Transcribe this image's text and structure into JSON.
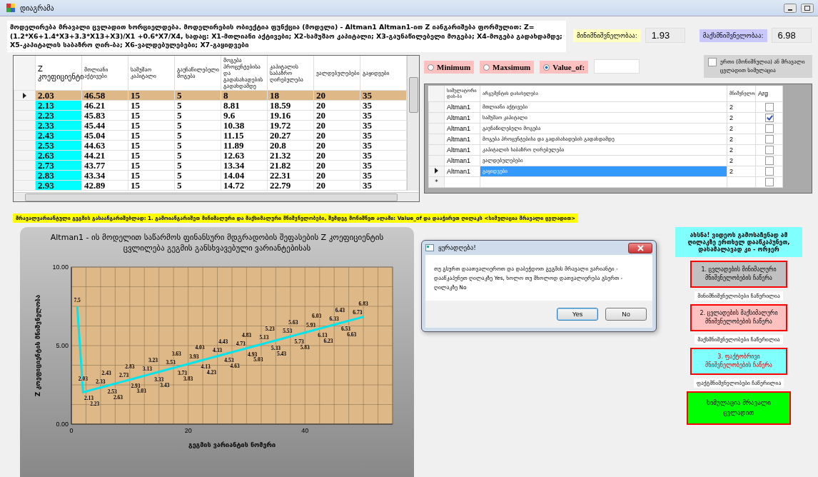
{
  "window": {
    "title": "დიაგრამა"
  },
  "description": "მოდელირება მრავალი ცვლადით ხორციელდება. მოდელირების ობიექტია ფუნქცია (მოდელი) - Altman1  Altman1-ით Z იანგარიშება ფორმულით: Z=(1.2*X6+1.4*X3+3.3*X13+X3)/X1 +0.6*X7/X4, სადაც: X1-მთლიანი აქტივები; X2-სამუშაო კაპიტალი; X3-გაუნაწილებელი მოგება; X4-მოგება გადახდამდე; X5-კაპიტალის საბაზრო ღირ-ბა; X6-ვალდებულებები; X7-გაყიდვები",
  "stats": [
    {
      "kind": "min",
      "label": "მინიმნიშვნელობაა:",
      "value": "1.93"
    },
    {
      "kind": "max",
      "label": "მაქსმნიშვნელობაა:",
      "value": "6.98"
    }
  ],
  "plan_grid": {
    "columns": [
      "Z კოეფიციენტი",
      "მთლიანი აქტივები",
      "სამუშაო კაპიტალი",
      "გაუნაწილებელი მოგება",
      "მოგება პროცენტებისა და გადასახადების გადახდამდე",
      "კაპიტალის საბაზრო ღირებულება",
      "ვალდებულებები",
      "გაყიდვები"
    ],
    "rows": [
      {
        "selected": true,
        "cells": [
          "2.03",
          "46.58",
          "15",
          "5",
          "8",
          "18",
          "20",
          "35"
        ]
      },
      {
        "selected": false,
        "cells": [
          "2.13",
          "46.21",
          "15",
          "5",
          "8.81",
          "18.59",
          "20",
          "35"
        ]
      },
      {
        "selected": false,
        "cells": [
          "2.23",
          "45.83",
          "15",
          "5",
          "9.6",
          "19.16",
          "20",
          "35"
        ]
      },
      {
        "selected": false,
        "cells": [
          "2.33",
          "45.44",
          "15",
          "5",
          "10.38",
          "19.72",
          "20",
          "35"
        ]
      },
      {
        "selected": false,
        "cells": [
          "2.43",
          "45.04",
          "15",
          "5",
          "11.15",
          "20.27",
          "20",
          "35"
        ]
      },
      {
        "selected": false,
        "cells": [
          "2.53",
          "44.63",
          "15",
          "5",
          "11.89",
          "20.8",
          "20",
          "35"
        ]
      },
      {
        "selected": false,
        "cells": [
          "2.63",
          "44.21",
          "15",
          "5",
          "12.63",
          "21.32",
          "20",
          "35"
        ]
      },
      {
        "selected": false,
        "cells": [
          "2.73",
          "43.77",
          "15",
          "5",
          "13.34",
          "21.82",
          "20",
          "35"
        ]
      },
      {
        "selected": false,
        "cells": [
          "2.83",
          "43.34",
          "15",
          "5",
          "14.04",
          "22.31",
          "20",
          "35"
        ]
      },
      {
        "selected": false,
        "cells": [
          "2.93",
          "42.89",
          "15",
          "5",
          "14.72",
          "22.79",
          "20",
          "35"
        ]
      }
    ]
  },
  "modes": [
    {
      "label": "Minimum",
      "selected": false
    },
    {
      "label": "Maxsimum",
      "selected": false
    },
    {
      "label": "Value_of:",
      "selected": true
    }
  ],
  "multi_variable": {
    "label": "ერთი (მონიშნულია) ან მრავალი ცვლადით სიმულაცია",
    "checked": false
  },
  "argument_grid": {
    "columns": [
      "სიმულატორი დას-ბა",
      "არგუმენტის დასახელება",
      "მნიშვნელო",
      "Arg"
    ],
    "rows": [
      {
        "selected": false,
        "simulator": "Altman1",
        "name": "მთლიანი აქტივები",
        "value": "2",
        "arg_checked": false
      },
      {
        "selected": false,
        "simulator": "Altman1",
        "name": "სამუშაო კაპიტალი",
        "value": "2",
        "arg_checked": true
      },
      {
        "selected": false,
        "simulator": "Altman1",
        "name": "გაუნაწილებელი მოგება",
        "value": "2",
        "arg_checked": false
      },
      {
        "selected": false,
        "simulator": "Altman1",
        "name": "მოგება პროცენტებისა და გადასახადების გადახდამდე",
        "value": "2",
        "arg_checked": false
      },
      {
        "selected": false,
        "simulator": "Altman1",
        "name": "კაპიტალის საბაზრო ღირებულება",
        "value": "2",
        "arg_checked": false
      },
      {
        "selected": false,
        "simulator": "Altman1",
        "name": "ვალდებულებები",
        "value": "2",
        "arg_checked": false
      },
      {
        "selected": true,
        "simulator": "Altman1",
        "name": "გაყიდვები",
        "value": "2",
        "arg_checked": false
      }
    ],
    "new_row": {
      "marker": "*",
      "arg_checked": false
    }
  },
  "instruction": "მრავალვარიანტული გეგმის გასაანგარიშებლად: 1. გამოიანგარიშეთ მინიმალური და მაქსიმალური მნიშვნელობები, შემდეგ მონიშნეთ ალამი: Value_of და დააჭირეთ ღილაკს <სიმულაცია მრავალი ცვლადით>",
  "chart": {
    "chart_data": {
      "type": "line",
      "title": "Altman1 - ის მოდელით საწარმოს ფინანსური მდგრადობის შეფასების  Z კოეფიციენტის ცვლილება გეგმის განსხვავებული ვარიანტებისას",
      "xlabel": "გეგმის ვარიანტის ნომერი",
      "ylabel": "Z კოეფიციენტის მნიშვნელობა",
      "x": [
        1,
        2,
        3,
        4,
        5,
        6,
        7,
        8,
        9,
        10,
        11,
        12,
        13,
        14,
        15,
        16,
        17,
        18,
        19,
        20,
        21,
        22,
        23,
        24,
        25,
        26,
        27,
        28,
        29,
        30,
        31,
        32,
        33,
        34,
        35,
        36,
        37,
        38,
        39,
        40,
        41,
        42,
        43,
        44,
        45,
        46,
        47,
        48,
        49,
        50
      ],
      "series": [
        {
          "color": "#00e5ee",
          "values": [
            7.5,
            2.03,
            2.13,
            2.23,
            2.33,
            2.43,
            2.53,
            2.63,
            2.73,
            2.83,
            2.93,
            3.03,
            3.13,
            3.23,
            3.33,
            3.43,
            3.53,
            3.63,
            3.73,
            3.83,
            3.93,
            4.03,
            4.13,
            4.23,
            4.33,
            4.43,
            4.53,
            4.63,
            4.73,
            4.83,
            4.93,
            5.03,
            5.13,
            5.23,
            5.33,
            5.43,
            5.53,
            5.63,
            5.73,
            5.83,
            5.93,
            6.03,
            6.13,
            6.23,
            6.33,
            6.43,
            6.53,
            6.63,
            6.73,
            6.83
          ]
        }
      ],
      "xlim": [
        0,
        55
      ],
      "ylim": [
        0,
        10
      ],
      "xticks": [
        0,
        20,
        40
      ],
      "yticks": [
        {
          "value": 0,
          "label": "0.00"
        },
        {
          "value": 5,
          "label": "5.00"
        },
        {
          "value": 10,
          "label": "10.00"
        }
      ],
      "data_labels": true,
      "grid": true
    }
  },
  "dialog": {
    "title": "ყურადღება!",
    "message": "თუ გსურთ დაათვალიეროთ და დაბეჭდოთ გეგმის მრავალი ვარიანტი  - დააწკაპუნეთ ღილაკზე Yes, ხოლო თუ მხოლოდ დათვალიერება გსურთ - ღილაკზე No",
    "buttons": [
      "Yes",
      "No"
    ]
  },
  "note": "ახსნა! ვიდეოს გამოსაჩენად ამ ღილაკზე ერთხელ დააწკაპუნეთ, დასამალავად კი - ორჯერ",
  "actions": [
    {
      "kind": "min",
      "label": "1. ცვლადების მინიმალური მნიშვნელობების ჩაწერა",
      "status": "მინიმნიშვნელობები ჩაწერილია"
    },
    {
      "kind": "max",
      "label": "2. ცვლადების მაქსიმალური მნიშვნელობების ჩაწერა",
      "status": "მაქსმნიშვნელობები ჩაწერილია"
    },
    {
      "kind": "fact",
      "label": "3. ფაქტობრივი მნიშვნელობების ჩაწერა",
      "status": "ფაქტმნიშვნელობები ჩაწერილია"
    },
    {
      "kind": "simulate",
      "label": "სიმულაცია მრავალი ცვლადით"
    }
  ]
}
